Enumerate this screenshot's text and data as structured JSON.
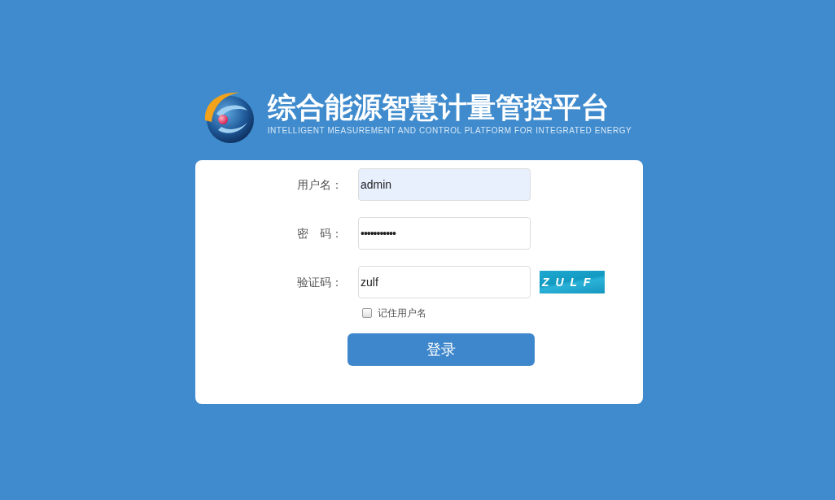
{
  "header": {
    "title": "综合能源智慧计量管控平台",
    "subtitle": "INTELLIGENT MEASUREMENT AND CONTROL PLATFORM FOR INTEGRATED ENERGY"
  },
  "form": {
    "fields": [
      {
        "kind": "text",
        "label": "用户名：",
        "value": "admin",
        "autofilled": true
      },
      {
        "kind": "password",
        "label": "密　码：",
        "value": "•••••••••••",
        "autofilled": false
      },
      {
        "kind": "captcha",
        "label": "验证码：",
        "value": "zulf",
        "autofilled": false,
        "captcha_image": "Z U L F"
      }
    ],
    "remember": {
      "label": "记住用户名",
      "checked": false
    },
    "submit": {
      "label": "登录"
    }
  }
}
